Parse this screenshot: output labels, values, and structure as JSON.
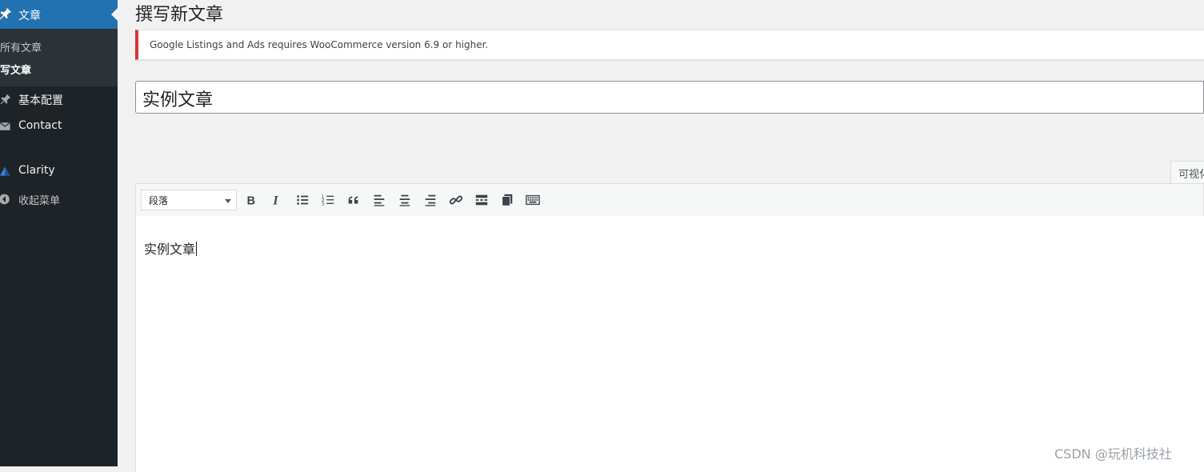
{
  "sidebar": {
    "active_menu": "文章",
    "submenu": [
      {
        "label": "所有文章",
        "current": false
      },
      {
        "label": "写文章",
        "current": true
      }
    ],
    "items": [
      {
        "label": "基本配置",
        "icon": "pin-icon"
      },
      {
        "label": "Contact",
        "icon": "envelope-icon"
      },
      {
        "label": "Clarity",
        "icon": "clarity-logo-icon"
      },
      {
        "label": "收起菜单",
        "icon": "collapse-arrow-icon"
      }
    ]
  },
  "page": {
    "title": "撰写新文章",
    "notice": "Google Listings and Ads requires WooCommerce version 6.9 or higher.",
    "post_title_value": "实例文章"
  },
  "editor": {
    "visual_tab_label": "可视化",
    "format_select_value": "段落",
    "toolbar_buttons": [
      "bold-icon",
      "italic-icon",
      "bulleted-list-icon",
      "numbered-list-icon",
      "blockquote-icon",
      "align-left-icon",
      "align-center-icon",
      "align-right-icon",
      "link-icon",
      "read-more-icon",
      "toolbar-toggle-icon",
      "keyboard-icon"
    ],
    "content": "实例文章"
  },
  "watermark": "CSDN @玩机科技社",
  "colors": {
    "sidebar_bg": "#1d2327",
    "accent": "#2271b1",
    "notice_error": "#d63638"
  }
}
